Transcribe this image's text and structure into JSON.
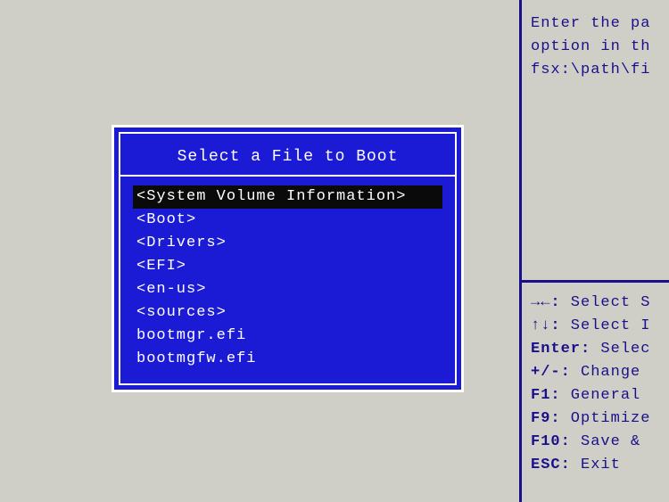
{
  "modal": {
    "title": "Select a File to Boot",
    "items": [
      {
        "label": "<System Volume Information>",
        "selected": true
      },
      {
        "label": "<Boot>",
        "selected": false
      },
      {
        "label": "<Drivers>",
        "selected": false
      },
      {
        "label": "<EFI>",
        "selected": false
      },
      {
        "label": "<en-us>",
        "selected": false
      },
      {
        "label": "<sources>",
        "selected": false
      },
      {
        "label": "bootmgr.efi",
        "selected": false
      },
      {
        "label": "bootmgfw.efi",
        "selected": false
      }
    ]
  },
  "help": {
    "top": [
      "Enter the pa",
      "option in th",
      "fsx:\\path\\fi"
    ],
    "bottom": [
      {
        "key": "→←:",
        "text": " Select S"
      },
      {
        "key": "↑↓:",
        "text": " Select I"
      },
      {
        "key": "Enter:",
        "text": " Selec"
      },
      {
        "key": "+/-:",
        "text": " Change "
      },
      {
        "key": "F1:",
        "text": " General "
      },
      {
        "key": "F9:",
        "text": " Optimize"
      },
      {
        "key": "F10:",
        "text": " Save & "
      },
      {
        "key": "ESC:",
        "text": " Exit"
      }
    ]
  }
}
